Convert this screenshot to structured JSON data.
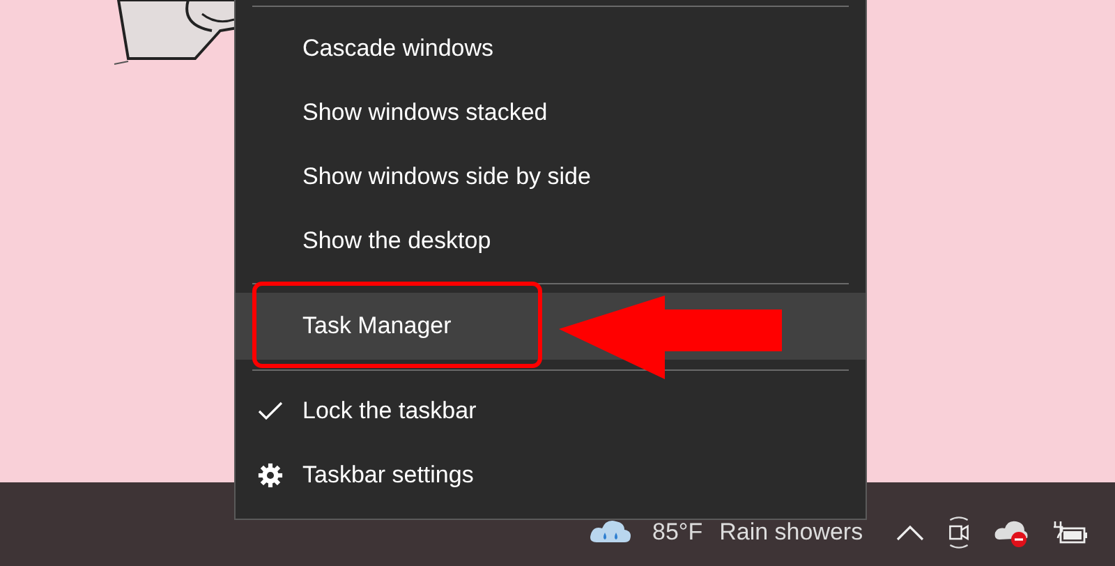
{
  "menu": {
    "items": [
      {
        "kind": "separator"
      },
      {
        "kind": "command",
        "label": "Cascade windows",
        "selected": false
      },
      {
        "kind": "command",
        "label": "Show windows stacked",
        "selected": false
      },
      {
        "kind": "command",
        "label": "Show windows side by side",
        "selected": false
      },
      {
        "kind": "command",
        "label": "Show the desktop",
        "selected": false
      },
      {
        "kind": "separator"
      },
      {
        "kind": "command",
        "label": "Task Manager",
        "selected": true
      },
      {
        "kind": "separator"
      },
      {
        "kind": "check",
        "label": "Lock the taskbar",
        "checked": true,
        "selected": false
      },
      {
        "kind": "settings",
        "label": "Taskbar settings",
        "selected": false
      }
    ]
  },
  "taskbar": {
    "weather": {
      "temperature": "85°F",
      "condition": "Rain showers"
    }
  }
}
